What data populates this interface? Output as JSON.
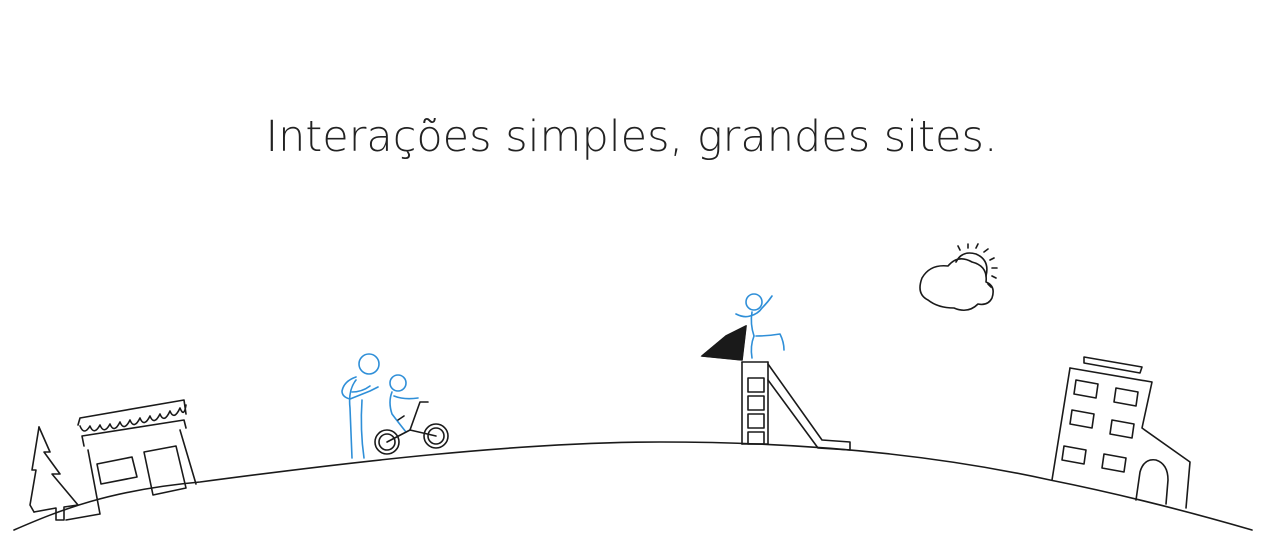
{
  "headline": {
    "text": "Interações simples, grandes sites."
  },
  "colors": {
    "text": "#222222",
    "line": "#1a1a1a",
    "accent": "#2f8fd8",
    "background": "#ffffff"
  },
  "illustration": {
    "icons": [
      "tree-icon",
      "shop-icon",
      "parent-child-bike-icon",
      "slide-icon",
      "cloud-sun-icon",
      "building-icon"
    ]
  }
}
